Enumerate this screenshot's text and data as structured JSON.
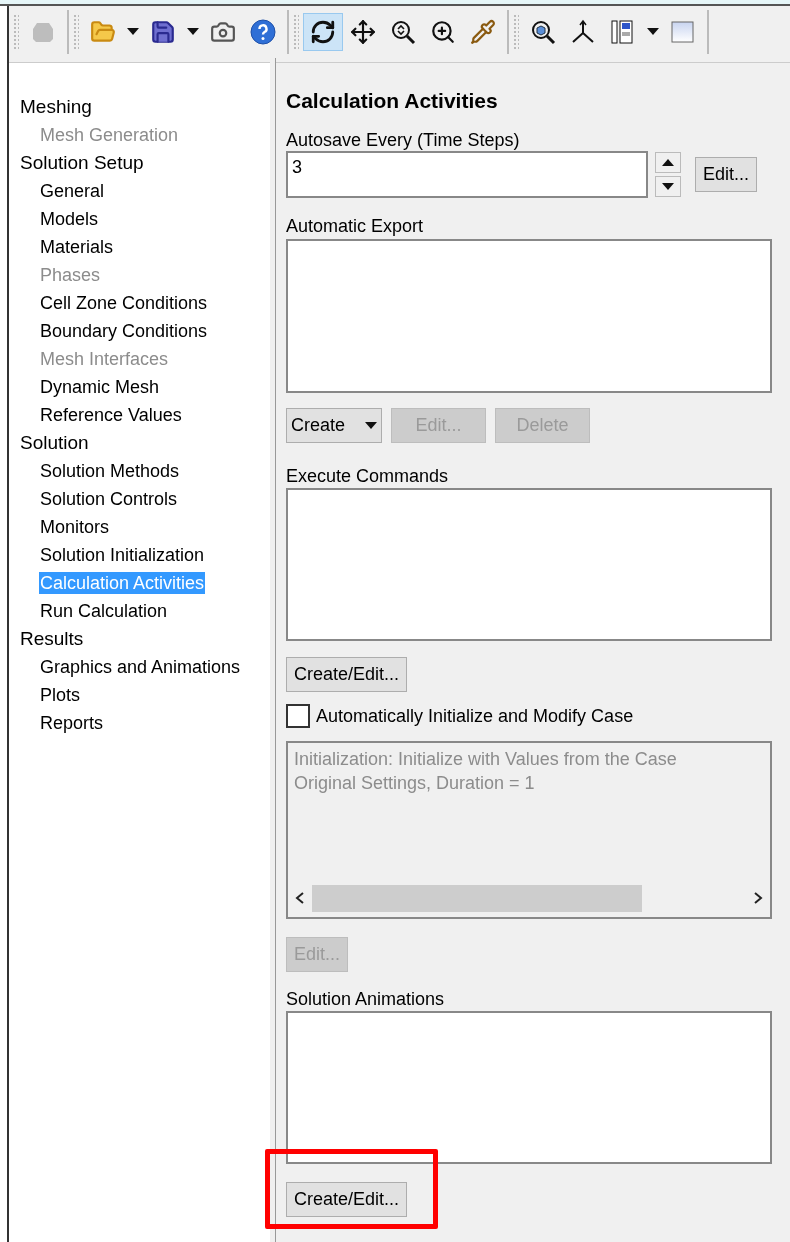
{
  "toolbar": {
    "groups": [
      {
        "tools": [
          {
            "disabled": true,
            "selected": false,
            "dropdown": false
          }
        ]
      },
      {
        "tools": [
          {
            "disabled": false,
            "selected": false,
            "dropdown": true
          },
          {
            "disabled": false,
            "selected": false,
            "dropdown": true
          },
          {
            "disabled": false,
            "selected": false,
            "dropdown": false
          },
          {
            "disabled": false,
            "selected": false,
            "dropdown": false
          }
        ]
      },
      {
        "tools": [
          {
            "disabled": false,
            "selected": true,
            "dropdown": false
          },
          {
            "disabled": false,
            "selected": false,
            "dropdown": false
          },
          {
            "disabled": false,
            "selected": false,
            "dropdown": false
          },
          {
            "disabled": false,
            "selected": false,
            "dropdown": false
          },
          {
            "disabled": false,
            "selected": false,
            "dropdown": false
          }
        ]
      },
      {
        "tools": [
          {
            "disabled": false,
            "selected": false,
            "dropdown": false
          },
          {
            "disabled": false,
            "selected": false,
            "dropdown": false
          },
          {
            "disabled": false,
            "selected": false,
            "dropdown": true
          },
          {
            "disabled": false,
            "selected": false,
            "dropdown": false
          }
        ]
      }
    ]
  },
  "tree": [
    {
      "label": "Meshing",
      "children": [
        {
          "label": "Mesh Generation",
          "disabled": true,
          "selected": false
        }
      ]
    },
    {
      "label": "Solution Setup",
      "children": [
        {
          "label": "General",
          "disabled": false,
          "selected": false
        },
        {
          "label": "Models",
          "disabled": false,
          "selected": false
        },
        {
          "label": "Materials",
          "disabled": false,
          "selected": false
        },
        {
          "label": "Phases",
          "disabled": true,
          "selected": false
        },
        {
          "label": "Cell Zone Conditions",
          "disabled": false,
          "selected": false
        },
        {
          "label": "Boundary Conditions",
          "disabled": false,
          "selected": false
        },
        {
          "label": "Mesh Interfaces",
          "disabled": true,
          "selected": false
        },
        {
          "label": "Dynamic Mesh",
          "disabled": false,
          "selected": false
        },
        {
          "label": "Reference Values",
          "disabled": false,
          "selected": false
        }
      ]
    },
    {
      "label": "Solution",
      "children": [
        {
          "label": "Solution Methods",
          "disabled": false,
          "selected": false
        },
        {
          "label": "Solution Controls",
          "disabled": false,
          "selected": false
        },
        {
          "label": "Monitors",
          "disabled": false,
          "selected": false
        },
        {
          "label": "Solution Initialization",
          "disabled": false,
          "selected": false
        },
        {
          "label": "Calculation Activities",
          "disabled": false,
          "selected": true
        },
        {
          "label": "Run Calculation",
          "disabled": false,
          "selected": false
        }
      ]
    },
    {
      "label": "Results",
      "children": [
        {
          "label": "Graphics and Animations",
          "disabled": false,
          "selected": false
        },
        {
          "label": "Plots",
          "disabled": false,
          "selected": false
        },
        {
          "label": "Reports",
          "disabled": false,
          "selected": false
        }
      ]
    }
  ],
  "panel": {
    "title": "Calculation Activities",
    "autosave": {
      "label": "Autosave Every (Time Steps)",
      "value": "3",
      "edit_button": "Edit..."
    },
    "automatic_export": {
      "label": "Automatic Export",
      "create_button": "Create",
      "edit_button": {
        "label": "Edit...",
        "disabled": true
      },
      "delete_button": {
        "label": "Delete",
        "disabled": true
      }
    },
    "execute_commands": {
      "label": "Execute Commands",
      "button": {
        "label": "Create/Edit...",
        "highlighted": false
      }
    },
    "auto_init": {
      "label": "Automatically Initialize and Modify Case",
      "checked": false,
      "lines": [
        "Initialization: Initialize with Values from the Case",
        "Original Settings, Duration = 1"
      ],
      "edit_button": {
        "label": "Edit...",
        "disabled": true
      }
    },
    "solution_animations": {
      "label": "Solution Animations",
      "button": {
        "label": "Create/Edit...",
        "highlighted": true
      }
    }
  }
}
